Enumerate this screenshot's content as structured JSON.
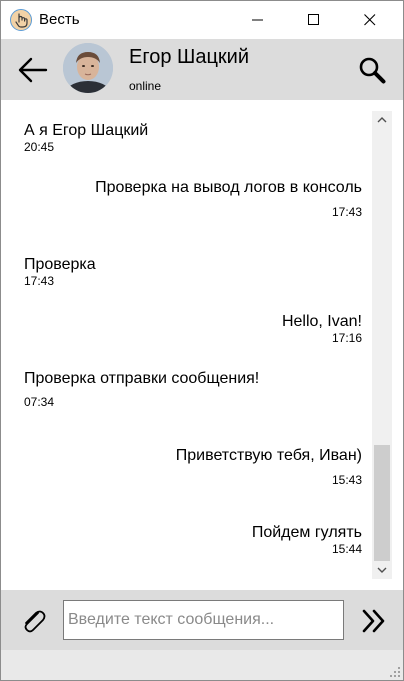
{
  "window": {
    "title": "Весть",
    "icons": {
      "app": "hand-pointer-icon",
      "minimize": "minimize-icon",
      "maximize": "maximize-icon",
      "close": "close-icon"
    }
  },
  "header": {
    "contact_name": "Егор Шацкий",
    "status": "online",
    "icons": {
      "back": "arrow-left-icon",
      "search": "search-icon"
    }
  },
  "messages": [
    {
      "direction": "in",
      "text": "А я Егор Шацкий",
      "time": "20:45"
    },
    {
      "direction": "out",
      "text": "Проверка на вывод логов в консоль",
      "time": "17:43"
    },
    {
      "direction": "in",
      "text": "Проверка",
      "time": "17:43"
    },
    {
      "direction": "out",
      "text": "Hello, Ivan!",
      "time": "17:16"
    },
    {
      "direction": "in",
      "text": "Проверка отправки сообщения!",
      "time": "07:34"
    },
    {
      "direction": "out",
      "text": "Приветствую тебя, Иван)",
      "time": "15:43"
    },
    {
      "direction": "out",
      "text": "Пойдем гулять",
      "time": "15:44"
    }
  ],
  "composer": {
    "placeholder": "Введите текст сообщения...",
    "value": "",
    "icons": {
      "attach": "paperclip-icon",
      "send": "double-chevron-right-icon"
    }
  },
  "colors": {
    "header_bg": "#dcdcdc",
    "composer_bg": "#dcdcdc",
    "scroll_thumb": "#cdcdcd"
  }
}
